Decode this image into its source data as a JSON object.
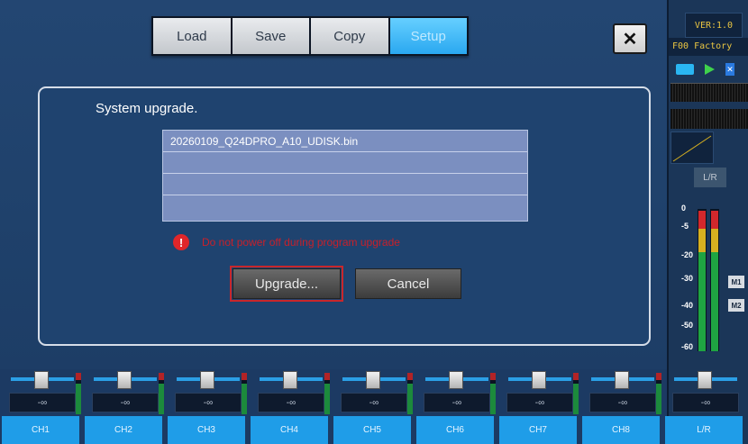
{
  "toolbar": {
    "tabs": [
      {
        "label": "Load"
      },
      {
        "label": "Save"
      },
      {
        "label": "Copy"
      },
      {
        "label": "Setup"
      }
    ],
    "close_label": "✕"
  },
  "dialog": {
    "title": "System upgrade.",
    "files": [
      "20260109_Q24DPRO_A10_UDISK.bin",
      "",
      "",
      ""
    ],
    "warning_icon": "!",
    "warning": "Do not power off during program upgrade",
    "upgrade_label": "Upgrade...",
    "cancel_label": "Cancel"
  },
  "side": {
    "version": "VER:1.0",
    "preset": "F00 Factory",
    "lr_tag": "L/R",
    "scale": [
      "0",
      "-5",
      "-20",
      "-30",
      "-40",
      "-50",
      "-60"
    ],
    "m1": "M1",
    "m2": "M2"
  },
  "channels": [
    {
      "label": "CH1",
      "value": "-∞"
    },
    {
      "label": "CH2",
      "value": "-∞"
    },
    {
      "label": "CH3",
      "value": "-∞"
    },
    {
      "label": "CH4",
      "value": "-∞"
    },
    {
      "label": "CH5",
      "value": "-∞"
    },
    {
      "label": "CH6",
      "value": "-∞"
    },
    {
      "label": "CH7",
      "value": "-∞"
    },
    {
      "label": "CH8",
      "value": "-∞"
    },
    {
      "label": "L/R",
      "value": "-∞"
    }
  ],
  "colors": {
    "accent": "#2aa8f0",
    "warning": "#c8202a",
    "meter_green": "#1fa442",
    "meter_yellow": "#d6b020",
    "meter_red": "#d2282c"
  }
}
